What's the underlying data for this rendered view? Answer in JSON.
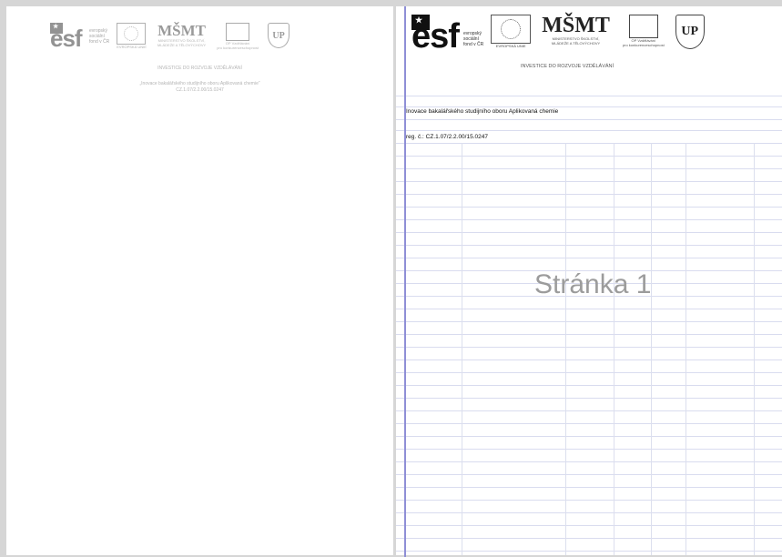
{
  "left_page": {
    "header": {
      "esf_text": [
        "evropský",
        "sociální",
        "fond v ČR"
      ],
      "eu_caption": "EVROPSKÁ UNIE",
      "msmt_logo": "MŠMT",
      "msmt_caption": [
        "MINISTERSTVO ŠKOLSTVÍ,",
        "MLÁDEŽE A TĚLOVÝCHOVY"
      ],
      "op_caption": [
        "OP Vzdělávání",
        "pro konkurenceschopnost"
      ],
      "shield_letter": "UP",
      "tagline": "INVESTICE DO ROZVOJE VZDĚLÁVÁNÍ",
      "project_line": "„Inovace bakalářského studijního oboru Aplikovaná chemie“",
      "reg_line": "CZ.1.07/2.2.00/15.0247"
    }
  },
  "right_page": {
    "header": {
      "esf_text": [
        "evropský",
        "sociální",
        "fond v ČR"
      ],
      "eu_caption": "EVROPSKÁ UNIE",
      "msmt_logo": "MŠMT",
      "msmt_caption": [
        "MINISTERSTVO ŠKOLSTVÍ,",
        "MLÁDEŽE A TĚLOVÝCHOVY"
      ],
      "op_caption": [
        "OP Vzdělávání",
        "pro konkurenceschopnost"
      ],
      "shield_letter": "UP",
      "tagline": "INVESTICE DO ROZVOJE VZDĚLÁVÁNÍ"
    },
    "cells": {
      "row1": "Inovace bakalářského studijního oboru Aplikovaná chemie",
      "row2": "reg. č.: CZ.1.07/2.2.00/15.0247"
    },
    "watermark": "Stránka 1"
  },
  "colors": {
    "background": "#d6d6d6",
    "page": "#ffffff",
    "gutter_line": "#8f8fd6",
    "grid_line": "#d9dcef",
    "watermark": "#9c9c9c"
  }
}
